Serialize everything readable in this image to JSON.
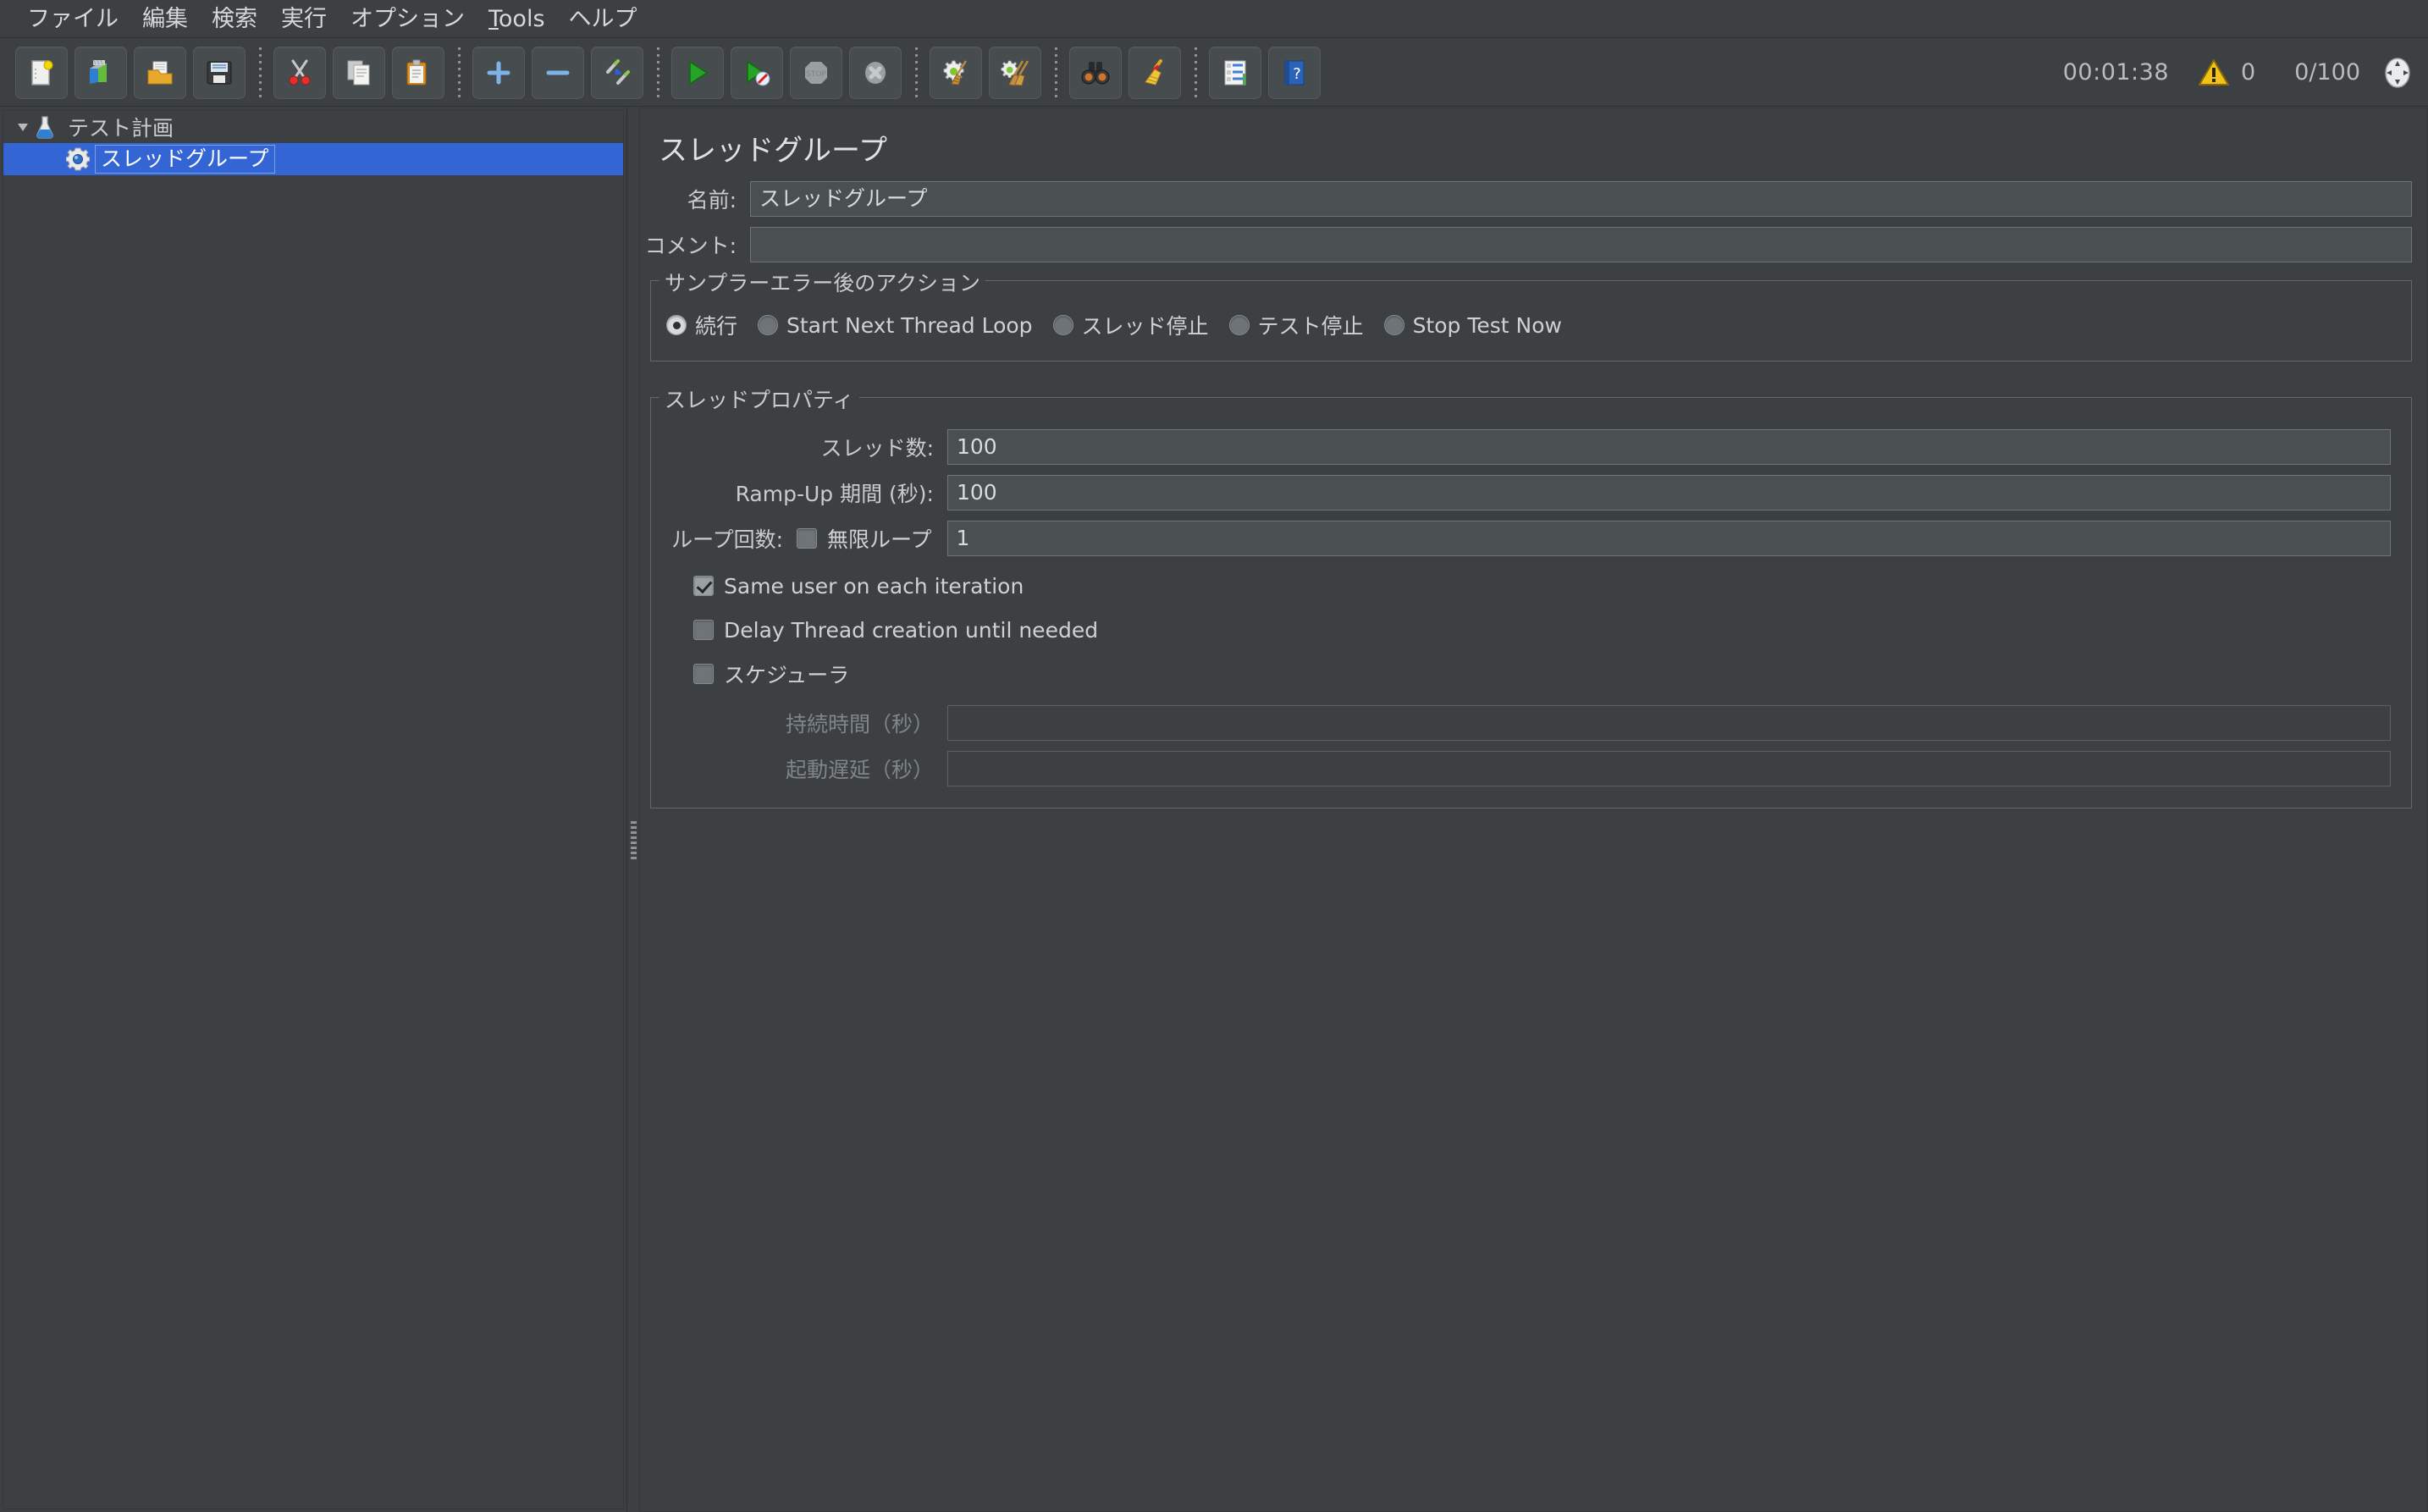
{
  "menubar": {
    "items": [
      {
        "label": "ファイル",
        "mnemonic": ""
      },
      {
        "label": "編集",
        "mnemonic": ""
      },
      {
        "label": "検索",
        "mnemonic": ""
      },
      {
        "label": "実行",
        "mnemonic": ""
      },
      {
        "label": "オプション",
        "mnemonic": ""
      },
      {
        "label": "Tools",
        "mnemonic": "T"
      },
      {
        "label": "ヘルプ",
        "mnemonic": ""
      }
    ]
  },
  "toolbar": {
    "buttons": [
      {
        "icon": "new-document-icon"
      },
      {
        "icon": "new-from-template-icon"
      },
      {
        "icon": "open-folder-icon"
      },
      {
        "icon": "save-floppy-icon"
      },
      {
        "sep": true
      },
      {
        "icon": "cut-scissors-icon"
      },
      {
        "icon": "copy-pages-icon"
      },
      {
        "icon": "paste-clipboard-icon"
      },
      {
        "sep": true
      },
      {
        "icon": "expand-plus-icon"
      },
      {
        "icon": "collapse-minus-icon"
      },
      {
        "icon": "toggle-pencils-icon"
      },
      {
        "sep": true
      },
      {
        "icon": "start-play-icon"
      },
      {
        "icon": "start-no-timers-icon"
      },
      {
        "icon": "stop-sign-icon"
      },
      {
        "icon": "shutdown-x-icon"
      },
      {
        "sep": true
      },
      {
        "icon": "clear-gear-broom-icon"
      },
      {
        "icon": "clear-all-brooms-icon"
      },
      {
        "sep": true
      },
      {
        "icon": "search-binoculars-icon"
      },
      {
        "icon": "reset-search-broom-icon"
      },
      {
        "sep": true
      },
      {
        "icon": "function-helper-icon"
      },
      {
        "icon": "help-book-icon"
      }
    ],
    "status": {
      "elapsed_time": "00:01:38",
      "warning_icon": "warning-triangle-icon",
      "warning_count": "0",
      "thread_counter": "0/100",
      "connection_icon": "connection-status-icon"
    }
  },
  "tree": {
    "nodes": [
      {
        "label": "テスト計画",
        "icon": "test-plan-flask-icon",
        "toggle": "expanded-triangle-icon",
        "selected": false,
        "level": 0
      },
      {
        "label": "スレッドグループ",
        "icon": "thread-group-gear-icon",
        "toggle": "",
        "selected": true,
        "level": 1
      }
    ]
  },
  "main": {
    "title": "スレッドグループ",
    "name_label": "名前:",
    "name_value": "スレッドグループ",
    "comment_label": "コメント:",
    "comment_value": "",
    "error_action": {
      "group_title": "サンプラーエラー後のアクション",
      "options": [
        {
          "label": "続行",
          "checked": true
        },
        {
          "label": "Start Next Thread Loop",
          "checked": false
        },
        {
          "label": "スレッド停止",
          "checked": false
        },
        {
          "label": "テスト停止",
          "checked": false
        },
        {
          "label": "Stop Test Now",
          "checked": false
        }
      ]
    },
    "thread_properties": {
      "group_title": "スレッドプロパティ",
      "thread_count_label": "スレッド数:",
      "thread_count_value": "100",
      "rampup_label": "Ramp-Up 期間 (秒):",
      "rampup_value": "100",
      "loop_label": "ループ回数:",
      "infinite_label": "無限ループ",
      "infinite_checked": false,
      "loop_value": "1",
      "same_user_label": "Same user on each iteration",
      "same_user_checked": true,
      "delay_thread_label": "Delay Thread creation until needed",
      "delay_thread_checked": false,
      "scheduler_label": "スケジューラ",
      "scheduler_checked": false,
      "duration_label": "持続時間（秒）",
      "duration_value": "",
      "startup_delay_label": "起動遅延（秒）",
      "startup_delay_value": ""
    }
  },
  "colors": {
    "background": "#3c4043",
    "field_background": "#4a4f52",
    "selection_blue": "#3465d4",
    "text": "#c9ccce",
    "border": "#63686b"
  }
}
